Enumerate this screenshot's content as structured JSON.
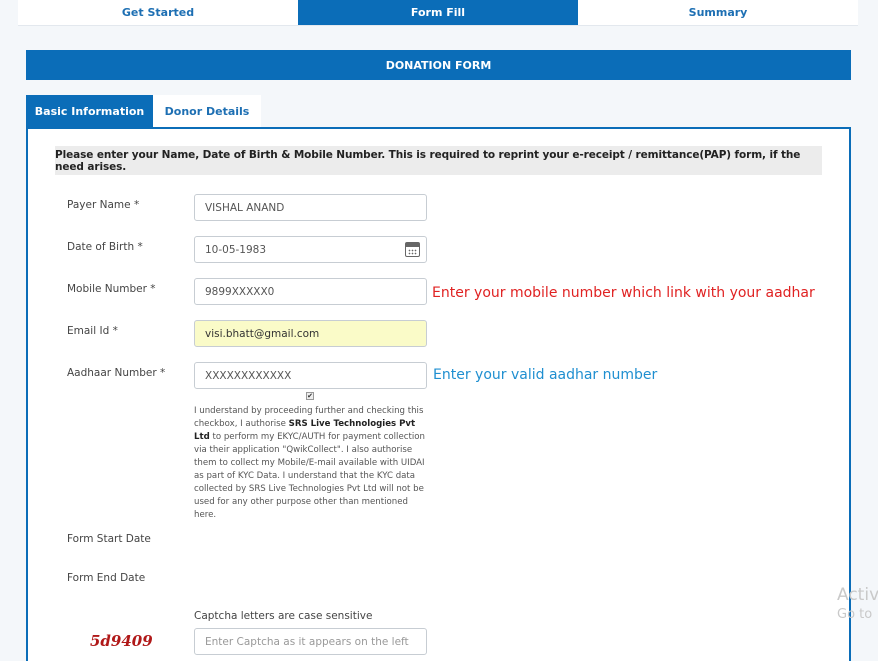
{
  "steps": [
    "Get Started",
    "Form Fill",
    "Summary"
  ],
  "form_title": "DONATION FORM",
  "tabs": [
    "Basic Information",
    "Donor Details"
  ],
  "notice": "Please enter your Name, Date of Birth & Mobile Number. This is required to reprint your e-receipt / remittance(PAP) form, if the need arises.",
  "fields": {
    "payer_name": {
      "label": "Payer Name *",
      "value": "VISHAL ANAND"
    },
    "dob": {
      "label": "Date of Birth *",
      "value": "10-05-1983"
    },
    "mobile": {
      "label": "Mobile Number *",
      "value": "9899XXXXX0"
    },
    "email": {
      "label": "Email Id *",
      "value": "visi.bhatt@gmail.com"
    },
    "aadhaar": {
      "label": "Aadhaar Number *",
      "value": "XXXXXXXXXXXX"
    }
  },
  "hints": {
    "mobile": "Enter your mobile number which link with your aadhar",
    "aadhaar": "Enter your valid aadhar number"
  },
  "consent": {
    "part1": "I understand by proceeding further and checking this checkbox, I authorise ",
    "company": "SRS Live Technologies Pvt Ltd",
    "part2": " to perform my EKYC/AUTH for payment collection via their application \"QwikCollect\". I also authorise them to collect my Mobile/E-mail available with UIDAI as part of KYC Data. I understand that the KYC data collected by SRS Live Technologies Pvt Ltd will not be used for any other purpose other than mentioned here.",
    "checked_mark": "✔"
  },
  "form_start_label": "Form Start Date",
  "form_end_label": "Form End Date",
  "captcha": {
    "note": "Captcha letters are case sensitive",
    "code": "5d9409",
    "placeholder": "Enter Captcha as it appears on the left"
  },
  "watermark": {
    "line1": "Activ",
    "line2": "Go to"
  },
  "colors": {
    "primary": "#0b6db8",
    "hint_red": "#e02222",
    "hint_blue": "#1f8fd0"
  }
}
